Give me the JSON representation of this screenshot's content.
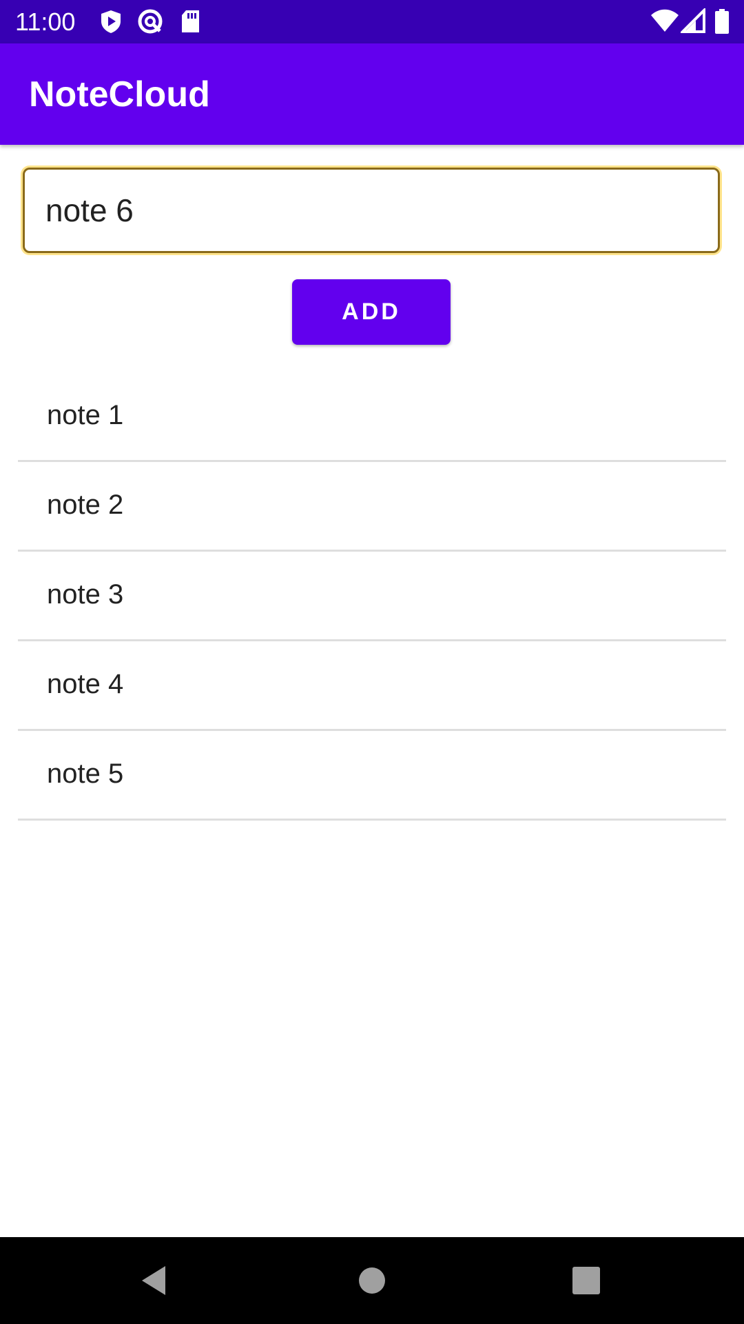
{
  "status_bar": {
    "time": "11:00",
    "icons": [
      "play-protect-icon",
      "data-saver-icon",
      "sd-card-icon",
      "wifi-icon",
      "cellular-signal-icon",
      "battery-icon"
    ]
  },
  "app_bar": {
    "title": "NoteCloud"
  },
  "note_input": {
    "value": "note 6"
  },
  "add_button": {
    "label": "ADD"
  },
  "notes": [
    {
      "text": "note 1"
    },
    {
      "text": "note 2"
    },
    {
      "text": "note 3"
    },
    {
      "text": "note 4"
    },
    {
      "text": "note 5"
    }
  ],
  "nav_bar": {
    "icons": [
      "back-icon",
      "home-icon",
      "recents-icon"
    ]
  },
  "colors": {
    "status_bar": "#3700b3",
    "primary": "#6200ee",
    "input_focus": "#ffc400",
    "divider": "#dedede"
  }
}
